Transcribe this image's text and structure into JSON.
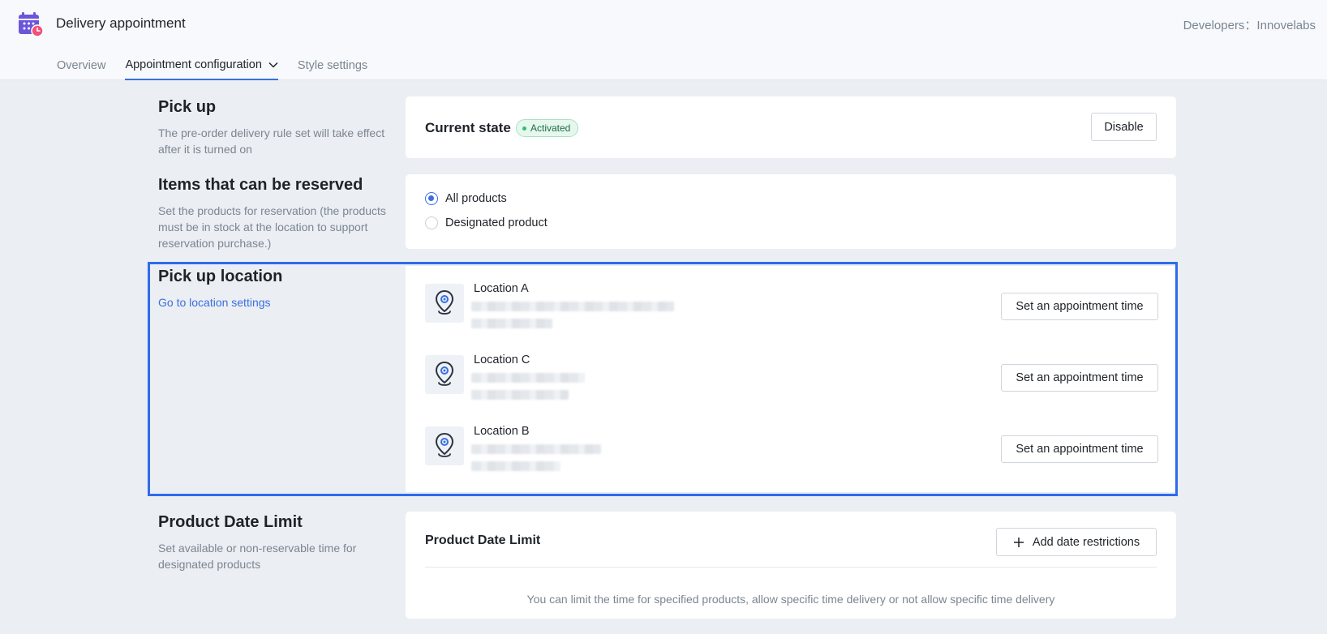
{
  "header": {
    "app_title": "Delivery appointment",
    "developer_label": "Developers：Innovelabs",
    "app_icon": "calendar-clock-icon",
    "tabs": [
      {
        "label": "Overview",
        "active": false
      },
      {
        "label": "Appointment configuration",
        "active": true
      },
      {
        "label": "Style settings",
        "active": false
      }
    ]
  },
  "pickup": {
    "title": "Pick up",
    "description": "The pre-order delivery rule set will take effect after it is turned on",
    "state_label": "Current state",
    "state_badge": "Activated",
    "disable_label": "Disable"
  },
  "reservable": {
    "title": "Items that can be reserved",
    "description": "Set the products for reservation (the products must be in stock at the location to support reservation purchase.)",
    "options": [
      {
        "label": "All products",
        "selected": true
      },
      {
        "label": "Designated product",
        "selected": false
      }
    ]
  },
  "pickup_location": {
    "title": "Pick up location",
    "link_label": "Go to location settings",
    "locations": [
      {
        "name": "Location A",
        "button_label": "Set an appointment time"
      },
      {
        "name": "Location C",
        "button_label": "Set an appointment time"
      },
      {
        "name": "Location B",
        "button_label": "Set an appointment time"
      }
    ]
  },
  "date_limit": {
    "title": "Product Date Limit",
    "description": "Set available or non-reservable time for designated products",
    "card_title": "Product Date Limit",
    "add_label": "Add date restrictions",
    "empty_text": "You can limit the time for specified products, allow specific time delivery or not allow specific time delivery"
  },
  "colors": {
    "accent": "#3a6fe0",
    "highlight_border": "#2f6bec",
    "badge_bg": "#e6f7ee",
    "badge_dot": "#2fbf71",
    "page_bg": "#ebeef2",
    "app_icon_purple": "#6b55d9",
    "app_icon_pink": "#f0507a"
  }
}
